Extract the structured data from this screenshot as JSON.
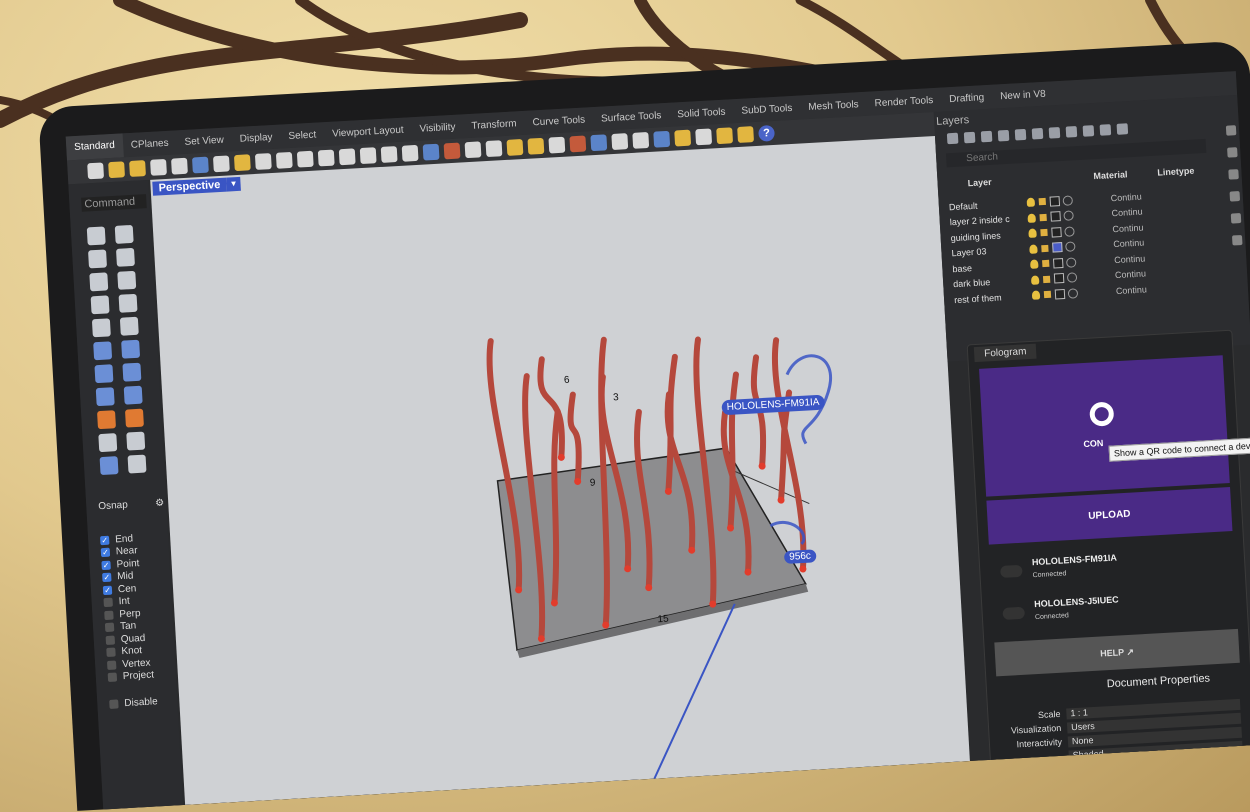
{
  "ribbon_tabs": [
    "Standard",
    "CPlanes",
    "Set View",
    "Display",
    "Select",
    "Viewport Layout",
    "Visibility",
    "Transform",
    "Curve Tools",
    "Surface Tools",
    "Solid Tools",
    "SubD Tools",
    "Mesh Tools",
    "Render Tools",
    "Drafting",
    "New in V8"
  ],
  "command_placeholder": "Command",
  "viewport": {
    "label": "Perspective",
    "hololens_tag": "HOLOLENS-FM91IA",
    "point_tag": "956c",
    "labels": [
      "6",
      "3",
      "9",
      "15"
    ]
  },
  "osnap": {
    "title": "Osnap",
    "items": [
      {
        "label": "End",
        "checked": true
      },
      {
        "label": "Near",
        "checked": true
      },
      {
        "label": "Point",
        "checked": true
      },
      {
        "label": "Mid",
        "checked": true
      },
      {
        "label": "Cen",
        "checked": true
      },
      {
        "label": "Int",
        "checked": false
      },
      {
        "label": "Perp",
        "checked": false
      },
      {
        "label": "Tan",
        "checked": false
      },
      {
        "label": "Quad",
        "checked": false
      },
      {
        "label": "Knot",
        "checked": false
      },
      {
        "label": "Vertex",
        "checked": false
      },
      {
        "label": "Project",
        "checked": false
      }
    ],
    "disable_label": "Disable"
  },
  "layers": {
    "title": "Layers",
    "search_placeholder": "Search",
    "col_layer": "Layer",
    "col_material": "Material",
    "col_linetype": "Linetype",
    "rows": [
      {
        "name": "Default",
        "linetype": "Continu",
        "color": "#222222"
      },
      {
        "name": "layer 2 inside c",
        "linetype": "Continu",
        "color": "#222222"
      },
      {
        "name": "guiding lines",
        "linetype": "Continu",
        "color": "#222222"
      },
      {
        "name": "Layer 03",
        "linetype": "Continu",
        "color": "#4a5cc8"
      },
      {
        "name": "base",
        "linetype": "Continu",
        "color": "#222222"
      },
      {
        "name": "dark blue",
        "linetype": "Continu",
        "color": "#222222"
      },
      {
        "name": "rest of them",
        "linetype": "Continu",
        "color": "#222222"
      }
    ]
  },
  "fologram": {
    "tab": "Fologram",
    "connect_label": "CON",
    "tooltip": "Show a QR code to connect a device",
    "upload_label": "UPLOAD",
    "devices": [
      {
        "name": "HOLOLENS-FM91IA",
        "status": "Connected"
      },
      {
        "name": "HOLOLENS-J5IUEC",
        "status": "Connected"
      }
    ],
    "help_label": "HELP"
  },
  "document_properties": {
    "title": "Document Properties",
    "rows": [
      {
        "label": "Scale",
        "value": "1 : 1"
      },
      {
        "label": "Visualization",
        "value": "Users"
      },
      {
        "label": "Interactivity",
        "value": "None"
      },
      {
        "label": "",
        "value": "Shaded"
      }
    ]
  },
  "colors": {
    "accent": "#3a55c4",
    "fologram_purple": "#4a2a86",
    "branch": "#b5483c",
    "node": "#e23c2c"
  }
}
